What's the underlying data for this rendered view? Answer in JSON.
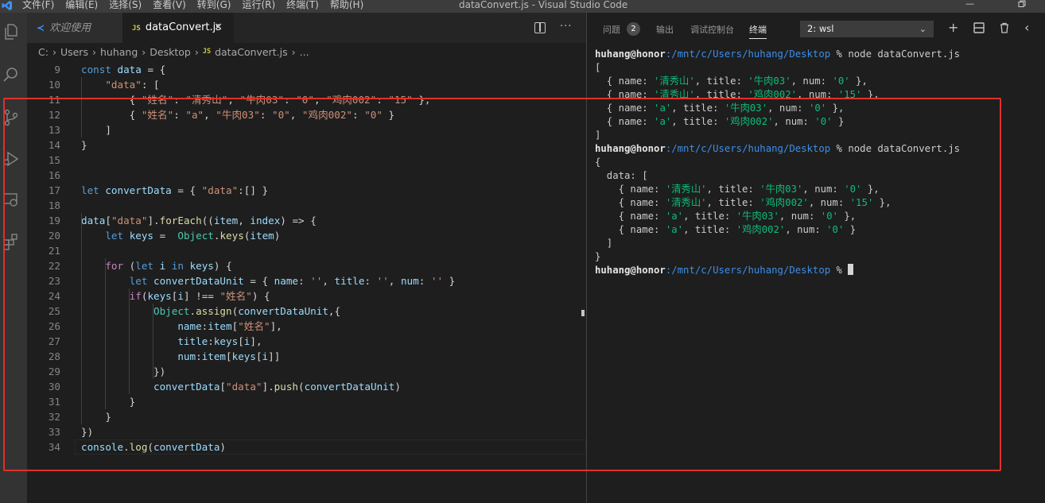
{
  "window": {
    "menu": [
      "文件(F)",
      "编辑(E)",
      "选择(S)",
      "查看(V)",
      "转到(G)",
      "运行(R)",
      "终端(T)",
      "帮助(H)"
    ],
    "title": "dataConvert.js - Visual Studio Code"
  },
  "editor": {
    "tabs": [
      {
        "label": "欢迎使用",
        "active": false
      },
      {
        "label": "dataConvert.js",
        "active": true
      }
    ],
    "breadcrumb": [
      "C:",
      "Users",
      "huhang",
      "Desktop",
      "dataConvert.js",
      "..."
    ],
    "lines": [
      {
        "n": "9",
        "text": "const data = {"
      },
      {
        "n": "10",
        "text": "    \"data\": ["
      },
      {
        "n": "11",
        "text": "        { \"姓名\": \"清秀山\", \"牛肉03\": \"0\", \"鸡肉002\": \"15\" },"
      },
      {
        "n": "12",
        "text": "        { \"姓名\": \"a\", \"牛肉03\": \"0\", \"鸡肉002\": \"0\" }"
      },
      {
        "n": "13",
        "text": "    ]"
      },
      {
        "n": "14",
        "text": "}"
      },
      {
        "n": "15",
        "text": ""
      },
      {
        "n": "16",
        "text": ""
      },
      {
        "n": "17",
        "text": "let convertData = { \"data\":[] }"
      },
      {
        "n": "18",
        "text": ""
      },
      {
        "n": "19",
        "text": "data[\"data\"].forEach((item, index) => {"
      },
      {
        "n": "20",
        "text": "    let keys =  Object.keys(item)"
      },
      {
        "n": "21",
        "text": ""
      },
      {
        "n": "22",
        "text": "    for (let i in keys) {"
      },
      {
        "n": "23",
        "text": "        let convertDataUnit = { name: '', title: '', num: '' }"
      },
      {
        "n": "24",
        "text": "        if(keys[i] !== \"姓名\") {"
      },
      {
        "n": "25",
        "text": "            Object.assign(convertDataUnit,{"
      },
      {
        "n": "26",
        "text": "                name:item[\"姓名\"],"
      },
      {
        "n": "27",
        "text": "                title:keys[i],"
      },
      {
        "n": "28",
        "text": "                num:item[keys[i]]"
      },
      {
        "n": "29",
        "text": "            })"
      },
      {
        "n": "30",
        "text": "            convertData[\"data\"].push(convertDataUnit)"
      },
      {
        "n": "31",
        "text": "        }"
      },
      {
        "n": "32",
        "text": "    }"
      },
      {
        "n": "33",
        "text": "})"
      },
      {
        "n": "34",
        "text": "console.log(convertData)"
      }
    ]
  },
  "panel": {
    "tabs": [
      {
        "label": "问题",
        "active": false
      },
      {
        "label": "输出",
        "active": false
      },
      {
        "label": "调试控制台",
        "active": false
      },
      {
        "label": "终端",
        "active": true
      }
    ],
    "problems_count": "2",
    "terminal_select": "2: wsl",
    "terminal": {
      "prompt_user": "huhang@honor",
      "prompt_path": ":/mnt/c/Users/huhang/Desktop",
      "prompt_symbol": " % ",
      "command": "node dataConvert.js",
      "output1": [
        "[",
        "  { name: '清秀山', title: '牛肉03', num: '0' },",
        "  { name: '清秀山', title: '鸡肉002', num: '15' },",
        "  { name: 'a', title: '牛肉03', num: '0' },",
        "  { name: 'a', title: '鸡肉002', num: '0' }",
        "]"
      ],
      "output2": [
        "{",
        "  data: [",
        "    { name: '清秀山', title: '牛肉03', num: '0' },",
        "    { name: '清秀山', title: '鸡肉002', num: '15' },",
        "    { name: 'a', title: '牛肉03', num: '0' },",
        "    { name: 'a', title: '鸡肉002', num: '0' }",
        "  ]",
        "}"
      ]
    }
  },
  "colors": {
    "annotation_box": "#e0302b",
    "accent": "#3794ff"
  }
}
